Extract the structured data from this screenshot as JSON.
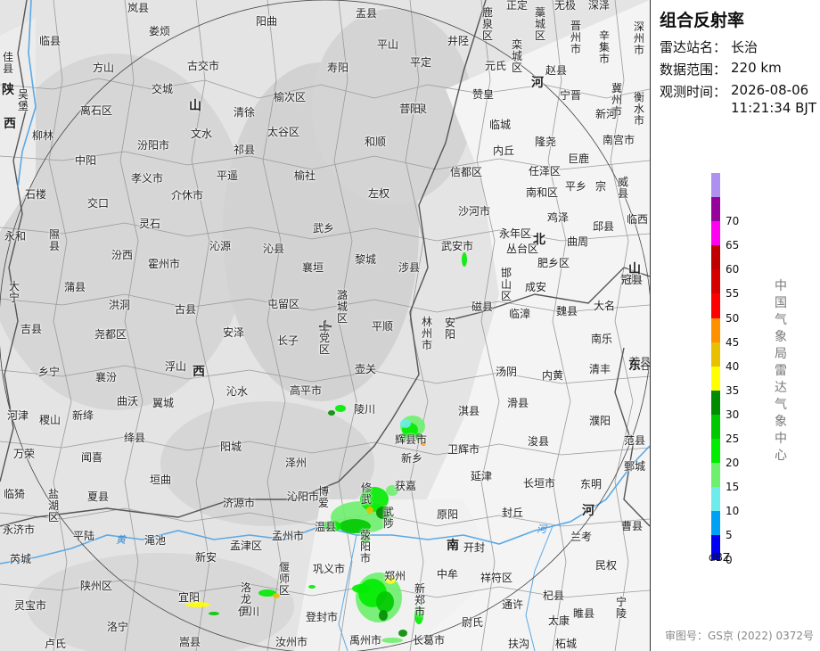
{
  "panel": {
    "title": "组合反射率",
    "station_label": "雷达站名：",
    "station_value": "长治",
    "range_label": "数据范围：",
    "range_value": "220 km",
    "time_label": "观测时间：",
    "time_date": "2026-08-06",
    "time_clock": "11:21:34 BJT",
    "unit": "dBZ",
    "organization": "中国气象局雷达气象中心",
    "approval": "审图号：GS京 (2022) 0372号"
  },
  "legend": [
    {
      "label": "",
      "color": "#ad90f0"
    },
    {
      "label": "70",
      "color": "#96009b"
    },
    {
      "label": "65",
      "color": "#ff00f0"
    },
    {
      "label": "60",
      "color": "#c00000"
    },
    {
      "label": "55",
      "color": "#d60000"
    },
    {
      "label": "50",
      "color": "#ff0000"
    },
    {
      "label": "45",
      "color": "#ff9000"
    },
    {
      "label": "40",
      "color": "#e7c000"
    },
    {
      "label": "35",
      "color": "#ffff00"
    },
    {
      "label": "30",
      "color": "#008c00"
    },
    {
      "label": "25",
      "color": "#00c800"
    },
    {
      "label": "20",
      "color": "#00ec00"
    },
    {
      "label": "15",
      "color": "#6df06d"
    },
    {
      "label": "10",
      "color": "#6eebeb"
    },
    {
      "label": "5",
      "color": "#00a0f5"
    },
    {
      "label": "0",
      "color": "#0000f5"
    }
  ],
  "map": {
    "radar_site": "长治",
    "provinces": [
      "山西",
      "河北",
      "山东",
      "河南",
      "陕西"
    ],
    "rivers": [
      "黄河"
    ],
    "cities": [
      "岚县",
      "娄烦",
      "阳曲",
      "盂县",
      "鹿泉区",
      "正定",
      "藁城区",
      "无极",
      "深泽",
      "临县",
      "方山",
      "古交市",
      "寿阳",
      "平山",
      "井陉",
      "元氏",
      "栾城区",
      "赵县",
      "晋州市",
      "辛集市",
      "深州市",
      "佳县",
      "吴堡",
      "交城",
      "榆次区",
      "平定",
      "阳泉",
      "赞皇",
      "宁晋",
      "衡水市",
      "冀州市",
      "离石区",
      "清徐",
      "昔阳",
      "临城",
      "新河",
      "柳林",
      "文水",
      "太谷区",
      "和顺",
      "内丘",
      "隆尧",
      "南宫市",
      "中阳",
      "汾阳市",
      "祁县",
      "平遥",
      "榆社",
      "信都区",
      "任泽区",
      "巨鹿",
      "孝义市",
      "介休市",
      "左权",
      "南和区",
      "平乡",
      "宗",
      "威县",
      "石楼",
      "交口",
      "灵石",
      "武乡",
      "沙河市",
      "鸡泽",
      "邱县",
      "临西",
      "永和",
      "隰县",
      "沁源",
      "沁县",
      "黎城",
      "涉县",
      "武安市",
      "永年区",
      "丛台区",
      "曲周",
      "汾西",
      "霍州市",
      "襄垣",
      "邯山区",
      "肥乡区",
      "馆陶",
      "冠县",
      "大宁",
      "蒲县",
      "屯留区",
      "潞城区",
      "磁县",
      "成安",
      "大名",
      "洪洞",
      "古县",
      "安泽",
      "长子",
      "上党区",
      "平顺",
      "林州市",
      "安阳",
      "临漳",
      "魏县",
      "南乐",
      "莘县",
      "吉县",
      "尧都区",
      "浮山",
      "壶关",
      "汤阴",
      "内黄",
      "清丰",
      "阳谷",
      "乡宁",
      "襄汾",
      "沁水",
      "高平市",
      "陵川",
      "滑县",
      "濮阳",
      "翼城",
      "辉县市",
      "淇县",
      "浚县",
      "河津",
      "稷山",
      "新绛",
      "曲沃",
      "绛县",
      "卫辉市",
      "延津",
      "长垣市",
      "东明",
      "范县",
      "万荣",
      "闻喜",
      "阳城",
      "泽州",
      "获嘉",
      "原阳",
      "封丘",
      "鄄城",
      "临猗",
      "盐湖区",
      "夏县",
      "垣曲",
      "济源市",
      "沁阳市",
      "博爱",
      "修武",
      "武陟",
      "新乡",
      "兰考",
      "曹县",
      "永济市",
      "平陆",
      "渑池",
      "孟津区",
      "孟州市",
      "温县",
      "荥阳市",
      "中牟",
      "开封",
      "民权",
      "芮城",
      "陕州区",
      "新安",
      "偃师区",
      "巩义市",
      "郑州",
      "祥符区",
      "通许",
      "杞县",
      "睢县",
      "宁陵",
      "灵宝市",
      "宜阳",
      "洛龙区",
      "伊川",
      "登封市",
      "新郑市",
      "尉氏",
      "太康",
      "洛宁",
      "嵩县",
      "汝州市",
      "禹州市",
      "长葛市",
      "扶沟",
      "柘城",
      "卢氏"
    ]
  }
}
